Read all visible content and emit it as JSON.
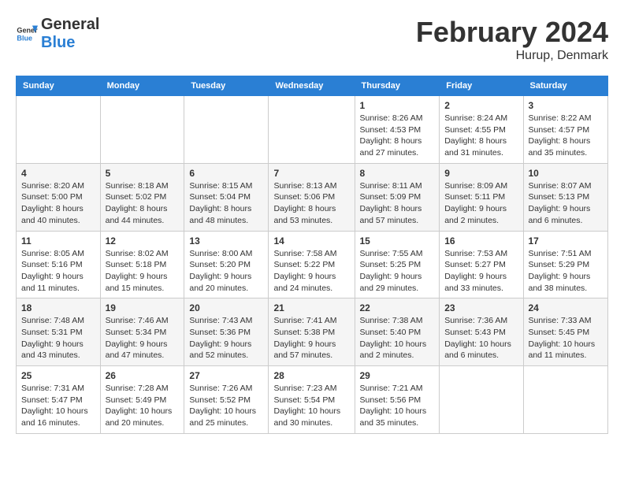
{
  "header": {
    "logo_line1": "General",
    "logo_line2": "Blue",
    "month_year": "February 2024",
    "location": "Hurup, Denmark"
  },
  "days_of_week": [
    "Sunday",
    "Monday",
    "Tuesday",
    "Wednesday",
    "Thursday",
    "Friday",
    "Saturday"
  ],
  "weeks": [
    [
      {
        "day": "",
        "text": ""
      },
      {
        "day": "",
        "text": ""
      },
      {
        "day": "",
        "text": ""
      },
      {
        "day": "",
        "text": ""
      },
      {
        "day": "1",
        "text": "Sunrise: 8:26 AM\nSunset: 4:53 PM\nDaylight: 8 hours\nand 27 minutes."
      },
      {
        "day": "2",
        "text": "Sunrise: 8:24 AM\nSunset: 4:55 PM\nDaylight: 8 hours\nand 31 minutes."
      },
      {
        "day": "3",
        "text": "Sunrise: 8:22 AM\nSunset: 4:57 PM\nDaylight: 8 hours\nand 35 minutes."
      }
    ],
    [
      {
        "day": "4",
        "text": "Sunrise: 8:20 AM\nSunset: 5:00 PM\nDaylight: 8 hours\nand 40 minutes."
      },
      {
        "day": "5",
        "text": "Sunrise: 8:18 AM\nSunset: 5:02 PM\nDaylight: 8 hours\nand 44 minutes."
      },
      {
        "day": "6",
        "text": "Sunrise: 8:15 AM\nSunset: 5:04 PM\nDaylight: 8 hours\nand 48 minutes."
      },
      {
        "day": "7",
        "text": "Sunrise: 8:13 AM\nSunset: 5:06 PM\nDaylight: 8 hours\nand 53 minutes."
      },
      {
        "day": "8",
        "text": "Sunrise: 8:11 AM\nSunset: 5:09 PM\nDaylight: 8 hours\nand 57 minutes."
      },
      {
        "day": "9",
        "text": "Sunrise: 8:09 AM\nSunset: 5:11 PM\nDaylight: 9 hours\nand 2 minutes."
      },
      {
        "day": "10",
        "text": "Sunrise: 8:07 AM\nSunset: 5:13 PM\nDaylight: 9 hours\nand 6 minutes."
      }
    ],
    [
      {
        "day": "11",
        "text": "Sunrise: 8:05 AM\nSunset: 5:16 PM\nDaylight: 9 hours\nand 11 minutes."
      },
      {
        "day": "12",
        "text": "Sunrise: 8:02 AM\nSunset: 5:18 PM\nDaylight: 9 hours\nand 15 minutes."
      },
      {
        "day": "13",
        "text": "Sunrise: 8:00 AM\nSunset: 5:20 PM\nDaylight: 9 hours\nand 20 minutes."
      },
      {
        "day": "14",
        "text": "Sunrise: 7:58 AM\nSunset: 5:22 PM\nDaylight: 9 hours\nand 24 minutes."
      },
      {
        "day": "15",
        "text": "Sunrise: 7:55 AM\nSunset: 5:25 PM\nDaylight: 9 hours\nand 29 minutes."
      },
      {
        "day": "16",
        "text": "Sunrise: 7:53 AM\nSunset: 5:27 PM\nDaylight: 9 hours\nand 33 minutes."
      },
      {
        "day": "17",
        "text": "Sunrise: 7:51 AM\nSunset: 5:29 PM\nDaylight: 9 hours\nand 38 minutes."
      }
    ],
    [
      {
        "day": "18",
        "text": "Sunrise: 7:48 AM\nSunset: 5:31 PM\nDaylight: 9 hours\nand 43 minutes."
      },
      {
        "day": "19",
        "text": "Sunrise: 7:46 AM\nSunset: 5:34 PM\nDaylight: 9 hours\nand 47 minutes."
      },
      {
        "day": "20",
        "text": "Sunrise: 7:43 AM\nSunset: 5:36 PM\nDaylight: 9 hours\nand 52 minutes."
      },
      {
        "day": "21",
        "text": "Sunrise: 7:41 AM\nSunset: 5:38 PM\nDaylight: 9 hours\nand 57 minutes."
      },
      {
        "day": "22",
        "text": "Sunrise: 7:38 AM\nSunset: 5:40 PM\nDaylight: 10 hours\nand 2 minutes."
      },
      {
        "day": "23",
        "text": "Sunrise: 7:36 AM\nSunset: 5:43 PM\nDaylight: 10 hours\nand 6 minutes."
      },
      {
        "day": "24",
        "text": "Sunrise: 7:33 AM\nSunset: 5:45 PM\nDaylight: 10 hours\nand 11 minutes."
      }
    ],
    [
      {
        "day": "25",
        "text": "Sunrise: 7:31 AM\nSunset: 5:47 PM\nDaylight: 10 hours\nand 16 minutes."
      },
      {
        "day": "26",
        "text": "Sunrise: 7:28 AM\nSunset: 5:49 PM\nDaylight: 10 hours\nand 20 minutes."
      },
      {
        "day": "27",
        "text": "Sunrise: 7:26 AM\nSunset: 5:52 PM\nDaylight: 10 hours\nand 25 minutes."
      },
      {
        "day": "28",
        "text": "Sunrise: 7:23 AM\nSunset: 5:54 PM\nDaylight: 10 hours\nand 30 minutes."
      },
      {
        "day": "29",
        "text": "Sunrise: 7:21 AM\nSunset: 5:56 PM\nDaylight: 10 hours\nand 35 minutes."
      },
      {
        "day": "",
        "text": ""
      },
      {
        "day": "",
        "text": ""
      }
    ]
  ]
}
